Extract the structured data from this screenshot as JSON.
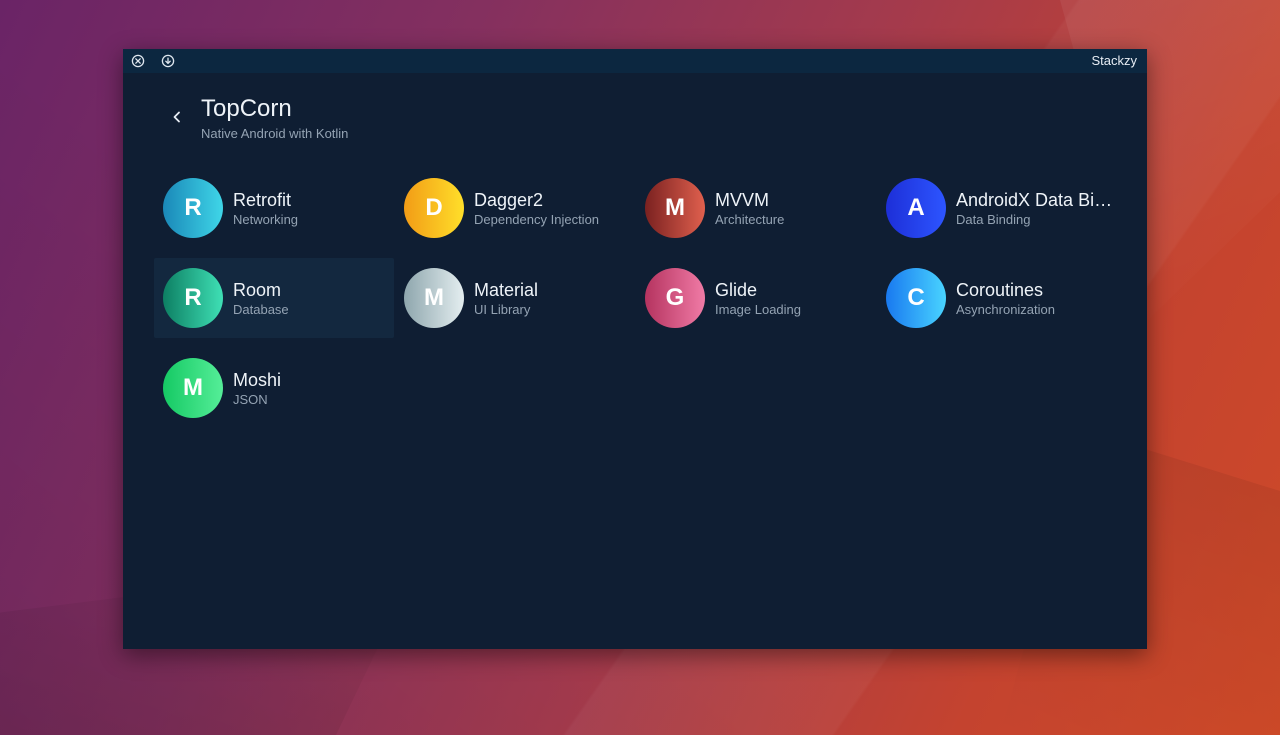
{
  "window": {
    "app_name": "Stackzy"
  },
  "header": {
    "title": "TopCorn",
    "subtitle": "Native Android with Kotlin"
  },
  "libraries": [
    {
      "letter": "R",
      "name": "Retrofit",
      "category": "Networking",
      "gradient": [
        "#1a88b8",
        "#3fd6e8"
      ],
      "selected": false
    },
    {
      "letter": "D",
      "name": "Dagger2",
      "category": "Dependency Injection",
      "gradient": [
        "#f29c16",
        "#ffdf2a"
      ],
      "selected": false
    },
    {
      "letter": "M",
      "name": "MVVM",
      "category": "Architecture",
      "gradient": [
        "#7a2120",
        "#e0604e"
      ],
      "selected": false
    },
    {
      "letter": "A",
      "name": "AndroidX Data Binding",
      "category": "Data Binding",
      "gradient": [
        "#1d2fd8",
        "#2d55ff"
      ],
      "selected": false
    },
    {
      "letter": "R",
      "name": "Room",
      "category": "Database",
      "gradient": [
        "#0d7f63",
        "#3fe0b5"
      ],
      "selected": true
    },
    {
      "letter": "M",
      "name": "Material",
      "category": "UI Library",
      "gradient": [
        "#8ea6ad",
        "#e4eef0"
      ],
      "selected": false
    },
    {
      "letter": "G",
      "name": "Glide",
      "category": "Image Loading",
      "gradient": [
        "#b5335f",
        "#f07ba6"
      ],
      "selected": false
    },
    {
      "letter": "C",
      "name": "Coroutines",
      "category": "Asynchronization",
      "gradient": [
        "#1979f0",
        "#49d4ff"
      ],
      "selected": false
    },
    {
      "letter": "M",
      "name": "Moshi",
      "category": "JSON",
      "gradient": [
        "#15c964",
        "#55ee98"
      ],
      "selected": false
    }
  ]
}
